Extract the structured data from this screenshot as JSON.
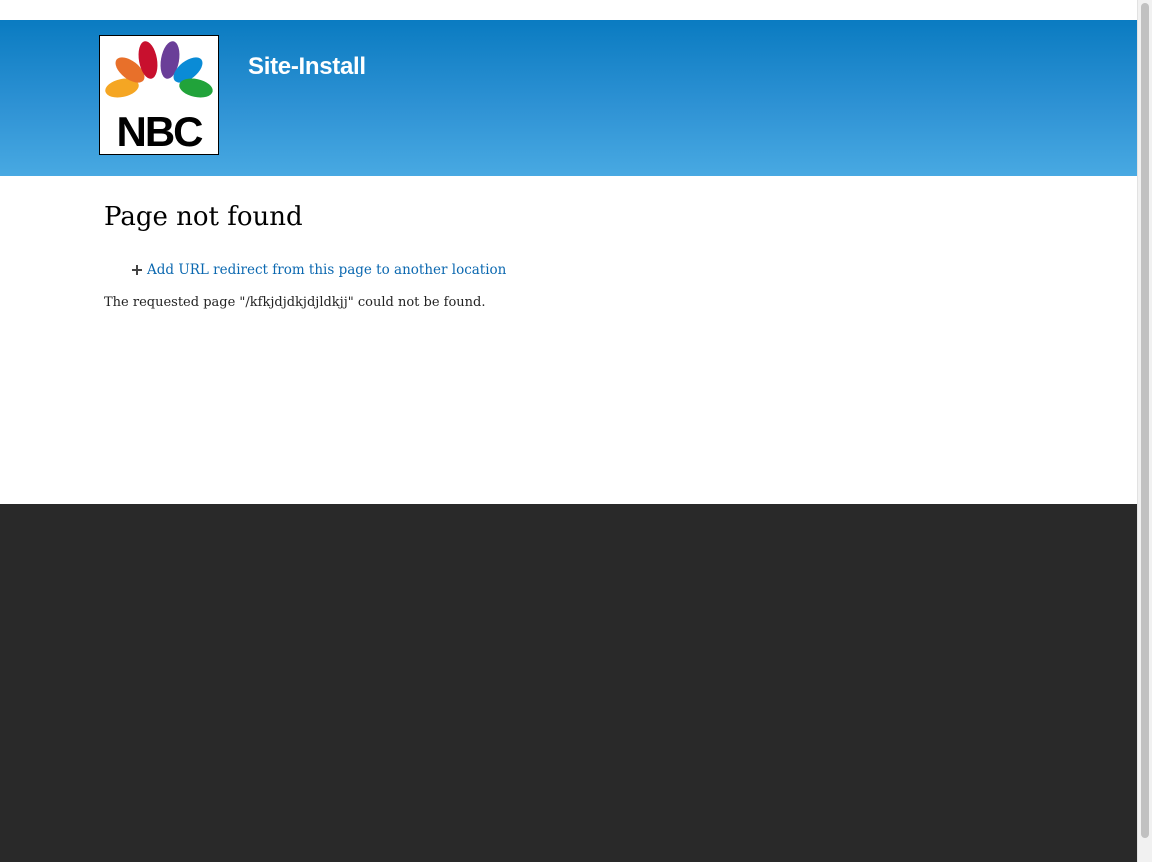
{
  "header": {
    "site_name": "Site-Install",
    "logo": {
      "text": "NBC",
      "feather_colors": [
        "#f5a623",
        "#e8702a",
        "#c8102e",
        "#6a3e98",
        "#0a8bd6",
        "#21a33a"
      ]
    },
    "background_color": "#1c87cc"
  },
  "main": {
    "page_title": "Page not found",
    "action_link": {
      "icon": "plus-icon",
      "label": "Add URL redirect from this page to another location"
    },
    "message": "The requested page \"/kfkjdjdkjdjldkjj\" could not be found."
  },
  "footer": {
    "background_color": "#292929"
  }
}
